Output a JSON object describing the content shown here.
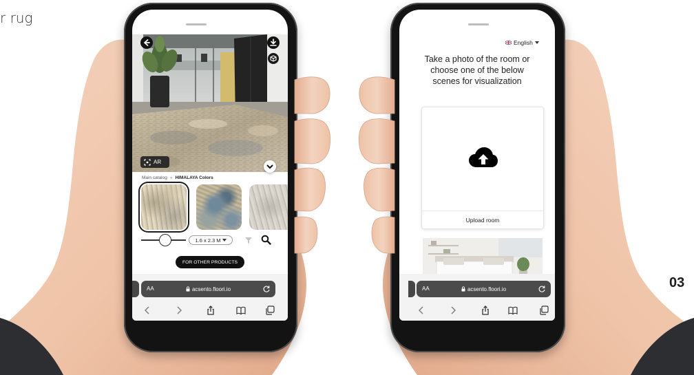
{
  "page": {
    "corner_text": "r rug",
    "page_number": "03"
  },
  "left_phone": {
    "ar_label": "AR",
    "breadcrumb": {
      "root": "Main catalog",
      "separator": "»",
      "current": "HIMALAYA Colors"
    },
    "selected_thumbnail": 0,
    "slider_value": 0.54,
    "size_label": "1.6 x 2.3 M",
    "other_products_label": "FOR OTHER PRODUCTS",
    "browser": {
      "text_size_label": "AA",
      "url": "acsento.floori.io"
    }
  },
  "right_phone": {
    "language": "English",
    "heading_lines": [
      "Take a photo of the room or",
      "choose one of the below",
      "scenes for visualization"
    ],
    "upload_label": "Upload room",
    "browser": {
      "text_size_label": "AA",
      "url": "acsento.floori.io"
    }
  },
  "icons": {
    "room_overlay": [
      "back-arrow-icon",
      "download-icon",
      "3d-view-icon",
      "ar-icon",
      "chevron-down-icon"
    ],
    "tools": [
      "filter-icon",
      "search-icon"
    ],
    "browser_toolbar": [
      "chevron-left-icon",
      "chevron-right-icon",
      "share-icon",
      "bookmarks-icon",
      "tabs-icon"
    ],
    "upload": "cloud-upload-icon",
    "language": "uk-flag-icon"
  },
  "colors": {
    "button": "#111111",
    "url_bar": "#4b4b4b",
    "skin": "#f0c8ad",
    "sleeve": "#2c2e31"
  }
}
